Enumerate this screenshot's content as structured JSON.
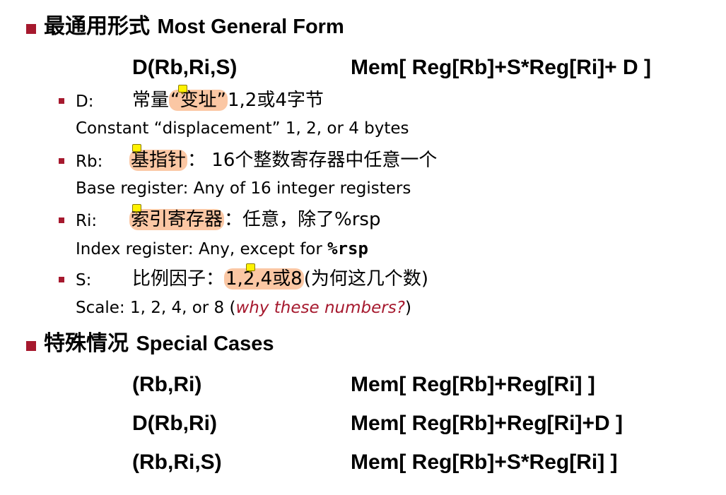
{
  "section1": {
    "title_cn": "最通用形式",
    "title_en": "Most General Form",
    "formula": {
      "left": "D(Rb,Ri,S)",
      "right": "Mem[ Reg[Rb]+S*Reg[Ri]+ D ]"
    },
    "items": [
      {
        "key": "D:",
        "cn_before": "常量",
        "cn_hl": "“变址”",
        "cn_after": "1,2或4字节",
        "en": "Constant “displacement” 1, 2, or 4 bytes"
      },
      {
        "key": "Rb:",
        "cn_hl": "基指针",
        "cn_after": "：  16个整数寄存器中任意一个",
        "en": "Base register: Any of 16 integer registers"
      },
      {
        "key": "Ri:",
        "cn_hl": "索引寄存器",
        "cn_after": "：任意，除了%rsp",
        "en_before": "Index register: Any, except for ",
        "en_code": "%rsp"
      },
      {
        "key": "S:",
        "cn_before": "比例因子：",
        "cn_hl": "1,2,4或8",
        "cn_after": "(为何这几个数)",
        "en_before": "Scale: 1, 2, 4, or 8 (",
        "en_italic": "why these numbers?",
        "en_after": ")"
      }
    ]
  },
  "section2": {
    "title_cn": "特殊情况",
    "title_en": "Special Cases",
    "cases": [
      {
        "left": "(Rb,Ri)",
        "right": "Mem[ Reg[Rb]+Reg[Ri] ]"
      },
      {
        "left": "D(Rb,Ri)",
        "right": "Mem[ Reg[Rb]+Reg[Ri]+D ]"
      },
      {
        "left": "(Rb,Ri,S)",
        "right": "Mem[ Reg[Rb]+S*Reg[Ri] ]"
      }
    ]
  },
  "colors": {
    "bullet": "#a6192e",
    "highlight": "#fbc7a4",
    "note_icon": "#fff200",
    "emphasis": "#a6192e"
  },
  "icons": {
    "bullet": "square-bullet",
    "comment": "comment-note-icon"
  }
}
